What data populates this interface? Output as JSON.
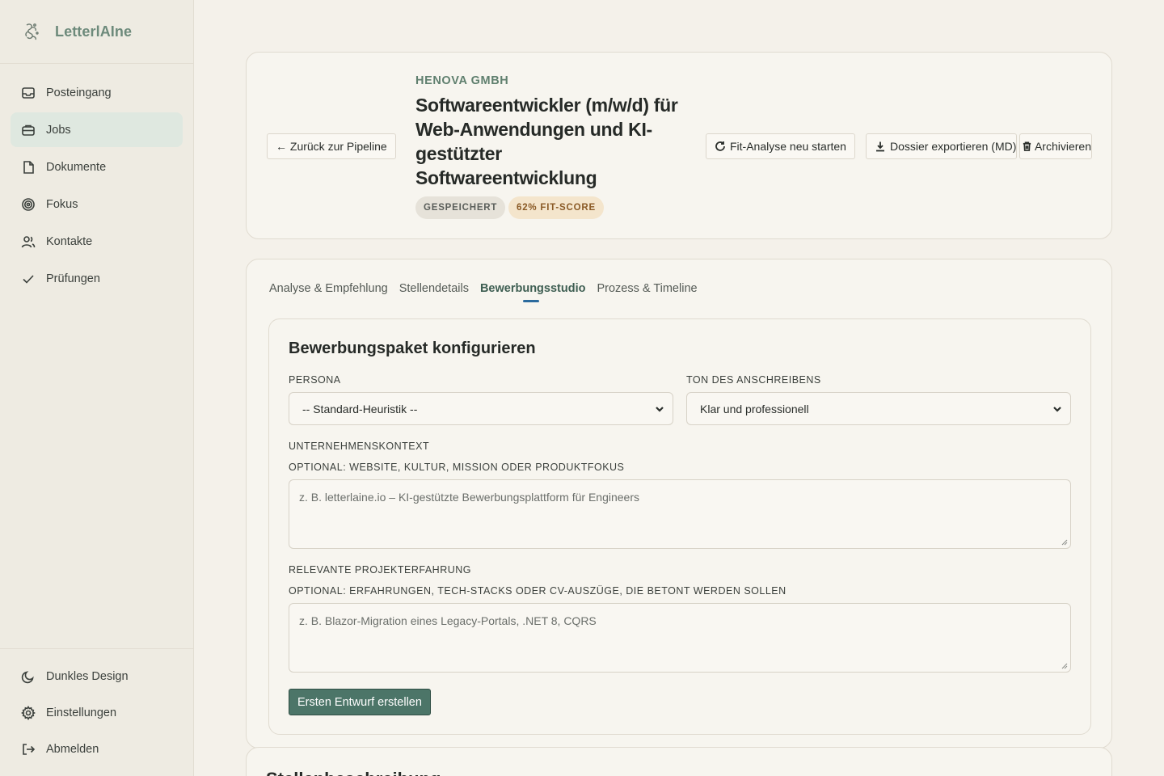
{
  "sidebar": {
    "brand": "LetterlAIne",
    "items": [
      {
        "label": "Posteingang",
        "icon": "inbox-icon"
      },
      {
        "label": "Jobs",
        "icon": "briefcase-icon",
        "active": true
      },
      {
        "label": "Dokumente",
        "icon": "document-icon"
      },
      {
        "label": "Fokus",
        "icon": "target-icon"
      },
      {
        "label": "Kontakte",
        "icon": "users-icon"
      },
      {
        "label": "Prüfungen",
        "icon": "check-icon"
      }
    ],
    "bottom": [
      {
        "label": "Dunkles Design",
        "icon": "moon-icon"
      },
      {
        "label": "Einstellungen",
        "icon": "gear-icon"
      },
      {
        "label": "Abmelden",
        "icon": "logout-icon"
      }
    ]
  },
  "header": {
    "back_label": "← Zurück zur Pipeline",
    "company": "HENOVA GMBH",
    "title": "Softwareentwickler (m/w/d) für Web-Anwendungen und KI-gestützter Softwareentwicklung",
    "badge_status": "GESPEICHERT",
    "badge_fit": "62% FIT-SCORE",
    "actions": {
      "rerun": "Fit-Analyse neu starten",
      "export": "Dossier exportieren (MD)",
      "archive": "Archivieren"
    }
  },
  "tabs": [
    {
      "label": "Analyse & Empfehlung"
    },
    {
      "label": "Stellendetails"
    },
    {
      "label": "Bewerbungsstudio",
      "active": true
    },
    {
      "label": "Prozess & Timeline"
    }
  ],
  "studio": {
    "title": "Bewerbungspaket konfigurieren",
    "persona_label": "PERSONA",
    "persona_value": "-- Standard-Heuristik --",
    "tone_label": "TON DES ANSCHREIBENS",
    "tone_value": "Klar und professionell",
    "company_context_label": "UNTERNEHMENSKONTEXT",
    "company_context_hint": "OPTIONAL: WEBSITE, KULTUR, MISSION ODER PRODUKTFOKUS",
    "company_context_placeholder": "z. B. letterlaine.io – KI-gestützte Bewerbungsplattform für Engineers",
    "experience_label": "RELEVANTE PROJEKTERFAHRUNG",
    "experience_hint": "OPTIONAL: ERFAHRUNGEN, TECH-STACKS ODER CV-AUSZÜGE, DIE BETONT WERDEN SOLLEN",
    "experience_placeholder": "z. B. Blazor-Migration eines Legacy-Portals, .NET 8, CQRS",
    "submit": "Ersten Entwurf erstellen"
  },
  "next_section_title": "Stellenbeschreibung"
}
